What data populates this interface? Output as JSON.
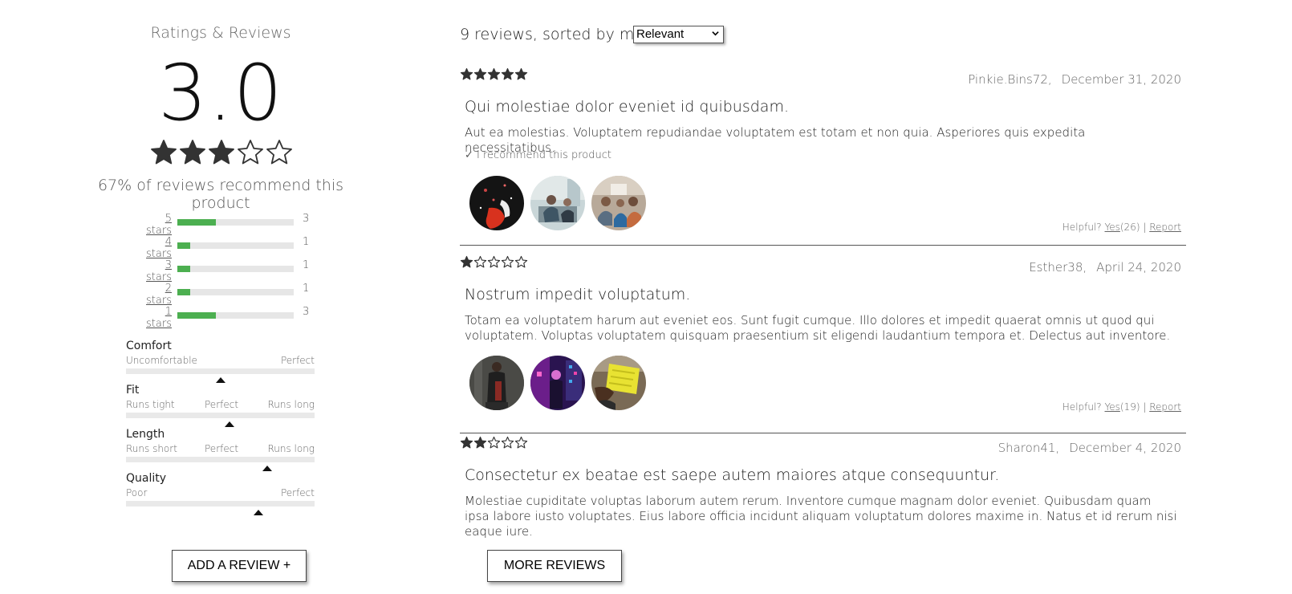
{
  "summary": {
    "title": "Ratings & Reviews",
    "average": "3.0",
    "average_stars": 3,
    "recommend_text": "67% of reviews recommend this product",
    "breakdown": [
      {
        "label": "5 stars",
        "count": "3",
        "fraction": 0.333
      },
      {
        "label": "4 stars",
        "count": "1",
        "fraction": 0.111
      },
      {
        "label": "3 stars",
        "count": "1",
        "fraction": 0.111
      },
      {
        "label": "2 stars",
        "count": "1",
        "fraction": 0.111
      },
      {
        "label": "1 stars",
        "count": "3",
        "fraction": 0.333
      }
    ],
    "characteristics": [
      {
        "name": "Comfort",
        "low": "Uncomfortable",
        "mid": "",
        "high": "Perfect",
        "value": 0.5
      },
      {
        "name": "Fit",
        "low": "Runs tight",
        "mid": "Perfect",
        "high": "Runs long",
        "value": 0.55
      },
      {
        "name": "Length",
        "low": "Runs short",
        "mid": "Perfect",
        "high": "Runs long",
        "value": 0.75
      },
      {
        "name": "Quality",
        "low": "Poor",
        "mid": "",
        "high": "Perfect",
        "value": 0.7
      }
    ],
    "bar_color": "#4caf50"
  },
  "list_header": {
    "text": "9 reviews, sorted by most",
    "sort_selected": "Relevant"
  },
  "reviews": [
    {
      "rating": 5,
      "user": "Pinkie.Bins72,",
      "date": "December 31, 2020",
      "summary": "Qui molestiae dolor eveniet id quibusdam.",
      "body": "Aut ea molestias. Voluptatem repudiandae voluptatem est totam et non quia. Asperiores quis expedita necessitatibus.",
      "recommend": "✓ I recommend this product",
      "helpful_label": "Helpful?",
      "yes_label": "Yes",
      "yes_count": "(26)",
      "separator": "|",
      "report_label": "Report"
    },
    {
      "rating": 1,
      "user": "Esther38,",
      "date": "April 24, 2020",
      "summary": "Nostrum impedit voluptatum.",
      "body": "Totam ea voluptatem harum aut eveniet eos. Sunt fugit cumque. Illo dolores et impedit quaerat omnis ut quod qui voluptatem. Voluptas voluptatem quisquam praesentium sit eligendi laudantium tempora et. Delectus aut inventore.",
      "helpful_label": "Helpful?",
      "yes_label": "Yes",
      "yes_count": "(19)",
      "separator": "|",
      "report_label": "Report"
    },
    {
      "rating": 2,
      "user": "Sharon41,",
      "date": "December 4, 2020",
      "summary": "Consectetur ex beatae est saepe autem maiores atque consequuntur.",
      "body": "Molestiae cupiditate voluptas laborum autem rerum. Inventore cumque magnam dolor eveniet. Quibusdam quam ipsa labore iusto voluptates. Eius labore officia incidunt aliquam voluptatum dolores maxime in. Natus et id rerum nisi eaque iure."
    }
  ],
  "buttons": {
    "add_review": "ADD A REVIEW +",
    "more_reviews": "MORE REVIEWS"
  }
}
